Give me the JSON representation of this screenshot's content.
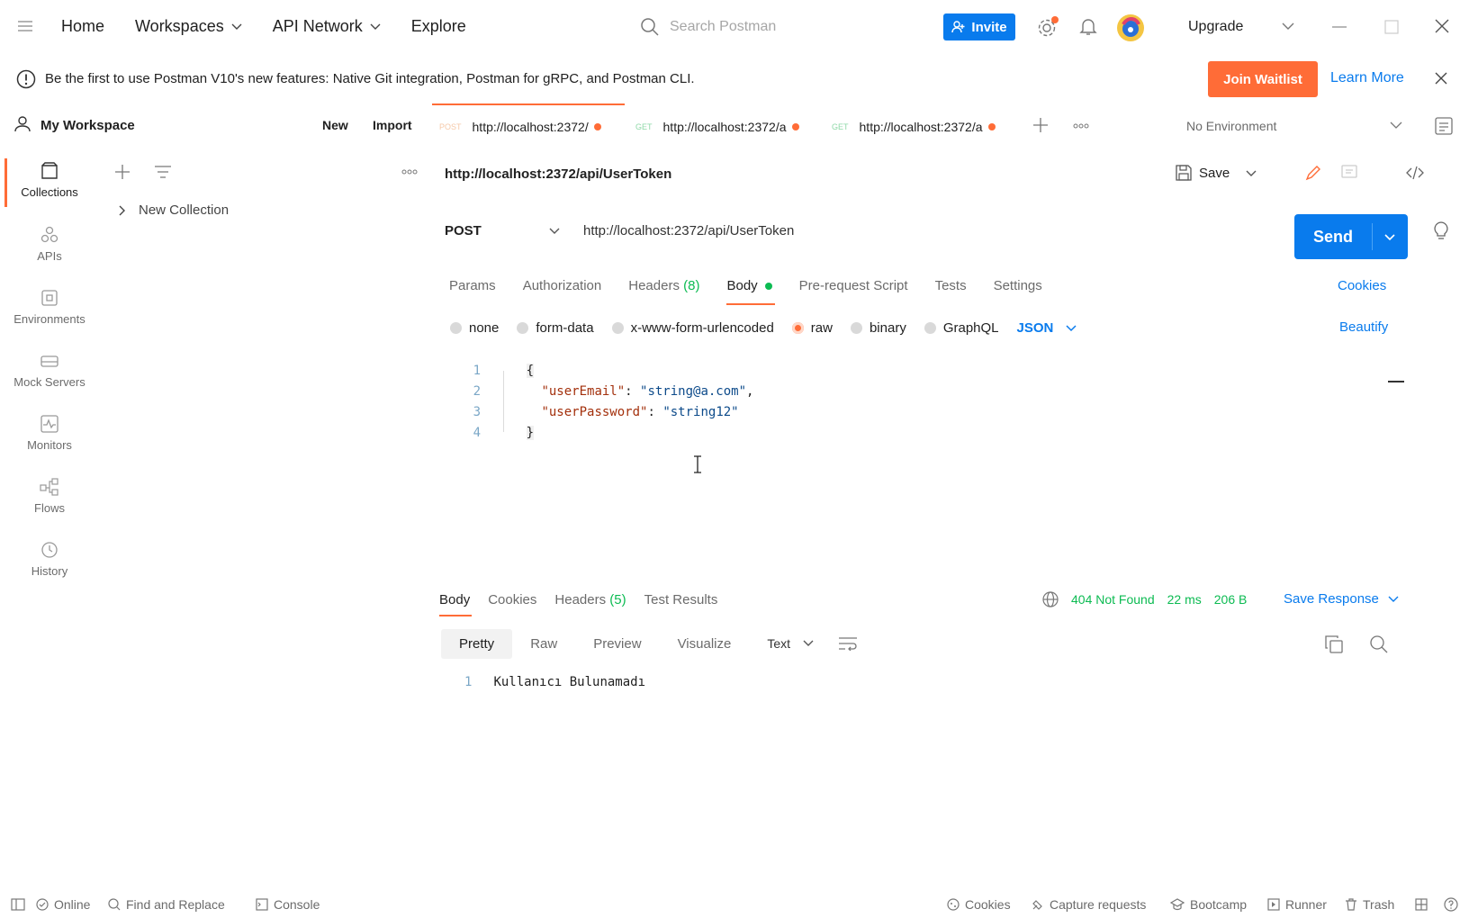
{
  "topbar": {
    "nav": [
      "Home",
      "Workspaces",
      "API Network",
      "Explore"
    ],
    "search_placeholder": "Search Postman",
    "invite_label": "Invite",
    "upgrade_label": "Upgrade"
  },
  "banner": {
    "message": "Be the first to use Postman V10's new features: Native Git integration, Postman for gRPC, and Postman CLI.",
    "join_label": "Join Waitlist",
    "learn_label": "Learn More"
  },
  "workspace": {
    "name": "My Workspace",
    "new_label": "New",
    "import_label": "Import"
  },
  "tabs": [
    {
      "method": "POST",
      "url": "http://localhost:2372/"
    },
    {
      "method": "GET",
      "url": "http://localhost:2372/a"
    },
    {
      "method": "GET",
      "url": "http://localhost:2372/a"
    }
  ],
  "environment": "No Environment",
  "rail": [
    "Collections",
    "APIs",
    "Environments",
    "Mock Servers",
    "Monitors",
    "Flows",
    "History"
  ],
  "sidebar": {
    "collection": "New Collection"
  },
  "request": {
    "title": "http://localhost:2372/api/UserToken",
    "save_label": "Save",
    "method": "POST",
    "url": "http://localhost:2372/api/UserToken",
    "send_label": "Send",
    "subtabs": [
      "Params",
      "Authorization",
      "Headers",
      "(8)",
      "Body",
      "Pre-request Script",
      "Tests",
      "Settings"
    ],
    "cookies_label": "Cookies",
    "body_types": [
      "none",
      "form-data",
      "x-www-form-urlencoded",
      "raw",
      "binary",
      "GraphQL"
    ],
    "format": "JSON",
    "beautify_label": "Beautify",
    "code": {
      "line_numbers": [
        "1",
        "2",
        "3",
        "4"
      ],
      "open": "{",
      "close": "}",
      "k1": "\"userEmail\"",
      "v1": "\"string@a.com\"",
      "k2": "\"userPassword\"",
      "v2": "\"string12\""
    }
  },
  "response": {
    "tabs": [
      "Body",
      "Cookies",
      "Headers",
      "(5)",
      "Test Results"
    ],
    "status": "404 Not Found",
    "time": "22 ms",
    "size": "206 B",
    "save_label": "Save Response",
    "views": [
      "Pretty",
      "Raw",
      "Preview",
      "Visualize"
    ],
    "format": "Text",
    "line_number": "1",
    "body": "Kullanıcı Bulunamadı"
  },
  "statusbar": {
    "left": [
      "Online",
      "Find and Replace",
      "Console"
    ],
    "right": [
      "Cookies",
      "Capture requests",
      "Bootcamp",
      "Runner",
      "Trash"
    ]
  },
  "colors": {
    "accent": "#FF6C37",
    "primary": "#097BED",
    "success": "#0CBB52"
  }
}
